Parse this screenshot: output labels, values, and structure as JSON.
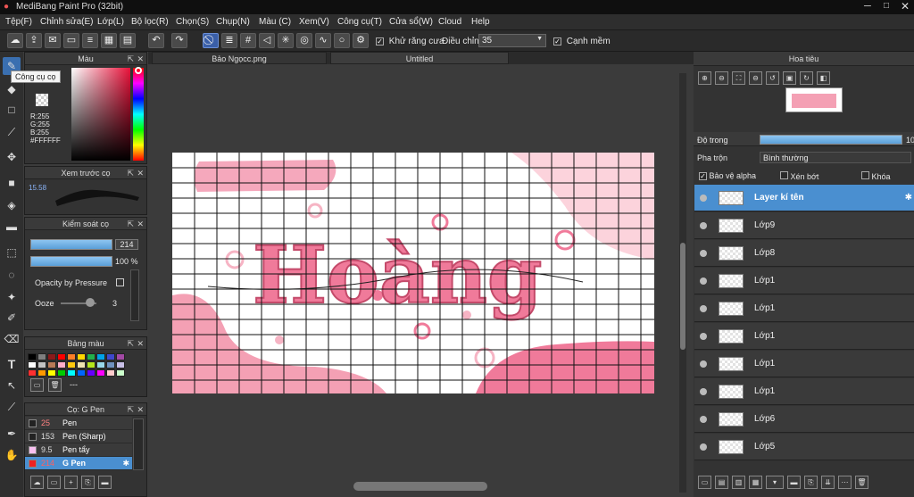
{
  "window": {
    "title": "MediBang Paint Pro (32bit)"
  },
  "menu": [
    "Tệp(F)",
    "Chỉnh sửa(E)",
    "Lớp(L)",
    "Bộ lọc(R)",
    "Chọn(S)",
    "Chụp(N)",
    "Màu (C)",
    "Xem(V)",
    "Công cụ(T)",
    "Cửa sổ(W)",
    "Cloud",
    "Help"
  ],
  "toolbar": {
    "antialias_label": "Khử răng cưa",
    "adjust_label": "Điều chỉnh",
    "adjust_value": "35",
    "smooth_label": "Cạnh mềm"
  },
  "tooltip": "Công cụ cọ",
  "color_panel": {
    "title": "Màu",
    "r": "R:255",
    "g": "G:255",
    "b": "B:255",
    "hex": "#FFFFFF"
  },
  "preview_panel": {
    "title": "Xem trước cọ",
    "size": "15.58"
  },
  "brush_control": {
    "title": "Kiểm soát cọ",
    "size_value": "214",
    "opacity_value": "100 %",
    "pressure_label": "Opacity by Pressure",
    "ooze_label": "Ooze",
    "ooze_value": "3"
  },
  "palette_panel": {
    "title": "Bảng màu",
    "dash": "---",
    "colors": [
      "#000000",
      "#7f7f7f",
      "#8b1a1a",
      "#ff0000",
      "#ff7f27",
      "#ffd700",
      "#22b14c",
      "#00a2e8",
      "#3f48cc",
      "#a349a4",
      "#ffffff",
      "#c3c3c3",
      "#b97a57",
      "#ffaec9",
      "#ffc90e",
      "#efe4b0",
      "#b5e61d",
      "#99d9ea",
      "#7092be",
      "#c8bfe7",
      "#ff3030",
      "#ff9900",
      "#ffff00",
      "#00cc00",
      "#00ffff",
      "#0066ff",
      "#6600ff",
      "#ff00ff",
      "#ffcccc",
      "#ccffcc"
    ]
  },
  "brush_list": {
    "title": "Cọ: G Pen",
    "items": [
      {
        "size": "25",
        "name": "Pen",
        "color": "#222"
      },
      {
        "size": "153",
        "name": "Pen (Sharp)",
        "color": "#222"
      },
      {
        "size": "9.5",
        "name": "Pen tẩy",
        "color": "#f8c0f0"
      },
      {
        "size": "214",
        "name": "G Pen",
        "color": "#e22",
        "selected": true
      }
    ]
  },
  "doc_tabs": [
    "Bảo Ngọcc.png",
    "Untitled"
  ],
  "navigator": {
    "title": "Hoa tiêu"
  },
  "layers_panel": {
    "title": "Lớp",
    "opacity_label": "Độ trong",
    "opacity_value": "10",
    "blend_label": "Pha trộn",
    "blend_value": "Bình thường",
    "protect_alpha": "Bảo vệ alpha",
    "clip": "Xén bớt",
    "lock": "Khóa"
  },
  "layers": [
    {
      "name": "Layer kí tên",
      "selected": true
    },
    {
      "name": "Lớp9"
    },
    {
      "name": "Lớp8"
    },
    {
      "name": "Lớp1"
    },
    {
      "name": "Lớp1"
    },
    {
      "name": "Lớp1"
    },
    {
      "name": "Lớp1"
    },
    {
      "name": "Lớp1"
    },
    {
      "name": "Lớp6"
    },
    {
      "name": "Lớp5"
    }
  ],
  "colors": {
    "accent": "#4a8fd0",
    "artwork_pink": "#f07a9a",
    "artwork_light": "#fcd3dc"
  }
}
